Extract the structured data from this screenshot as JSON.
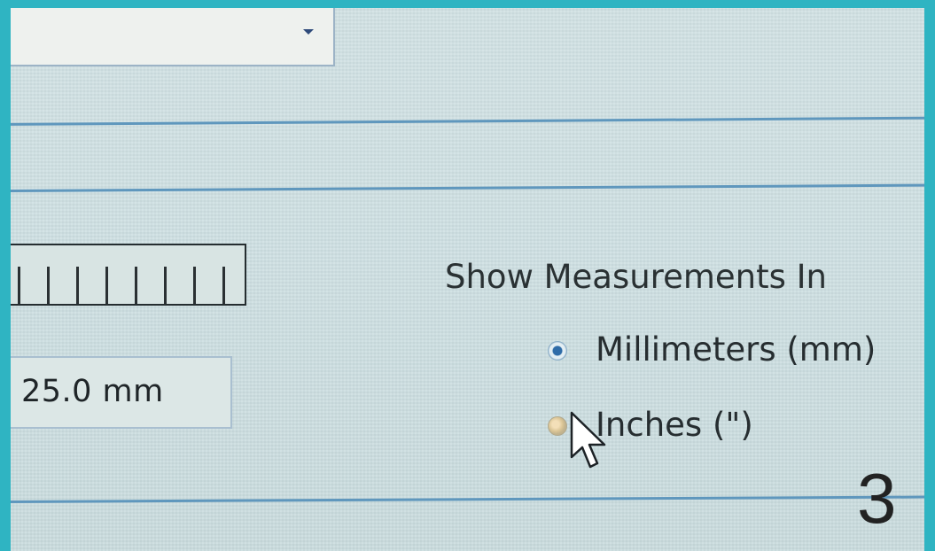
{
  "measurements": {
    "title": "Show Measurements In",
    "options": [
      {
        "label": "Millimeters (mm)",
        "selected": true
      },
      {
        "label": "Inches (\")",
        "selected": false
      }
    ]
  },
  "size_field": {
    "value": "25.0 mm"
  },
  "step_badge": {
    "number": "3"
  },
  "colors": {
    "frame_border": "#2fb4c2",
    "separator": "#5f97bd",
    "radio_selected": "#2f6ca8"
  }
}
